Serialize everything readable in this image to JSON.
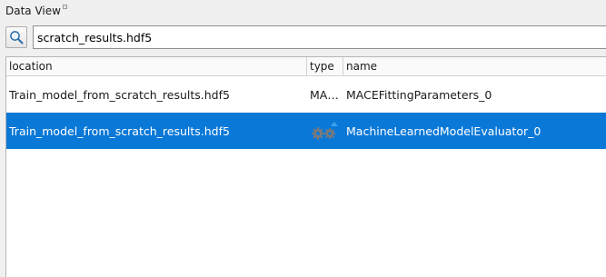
{
  "panel": {
    "title": "Data View"
  },
  "search": {
    "value": "scratch_results.hdf5",
    "icon": "search-icon"
  },
  "table": {
    "columns": [
      "location",
      "type",
      "name"
    ],
    "rows": [
      {
        "location": "Train_model_from_scratch_results.hdf5",
        "type": "MA…",
        "name": "MACEFittingParameters_0",
        "selected": false
      },
      {
        "location": "Train_model_from_scratch_results.hdf5",
        "type_icon": "gears-icon",
        "name": "MachineLearnedModelEvaluator_0",
        "selected": true
      }
    ]
  },
  "colors": {
    "selection": "#0a78d7",
    "gear_dark": "#7a7a7a",
    "gear_accent": "#3aa0e8"
  }
}
